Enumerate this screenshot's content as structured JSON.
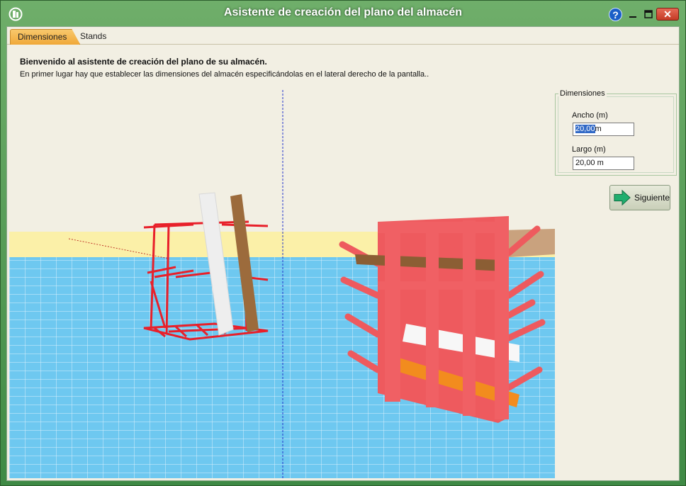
{
  "window": {
    "title": "Asistente de creación del plano del almacén",
    "controls": {
      "help": "?",
      "close": "✕"
    }
  },
  "tabs": [
    {
      "label": "Dimensiones",
      "active": true
    },
    {
      "label": "Stands",
      "active": false
    }
  ],
  "intro": {
    "heading": "Bienvenido al asistente de creación del plano de su almacén.",
    "text": "En primer lugar hay que establecer las dimensiones del almacén especificándolas en el lateral derecho de la pantalla.."
  },
  "dimensions": {
    "legend": "Dimensiones",
    "width_label": "Ancho (m)",
    "width_value": "20,00",
    "width_unit": "m",
    "length_label": "Largo (m)",
    "length_value": "20,00 m"
  },
  "next_button": {
    "label": "Siguiente",
    "icon": "arrow-right-icon"
  },
  "colors": {
    "floor": "#6ec8f0",
    "grid": "#ffffff",
    "wall": "#fbf0a8",
    "rack_small": "#e8202a",
    "rack_large": "#ee5a5e",
    "accent_tab": "#f0a838"
  }
}
